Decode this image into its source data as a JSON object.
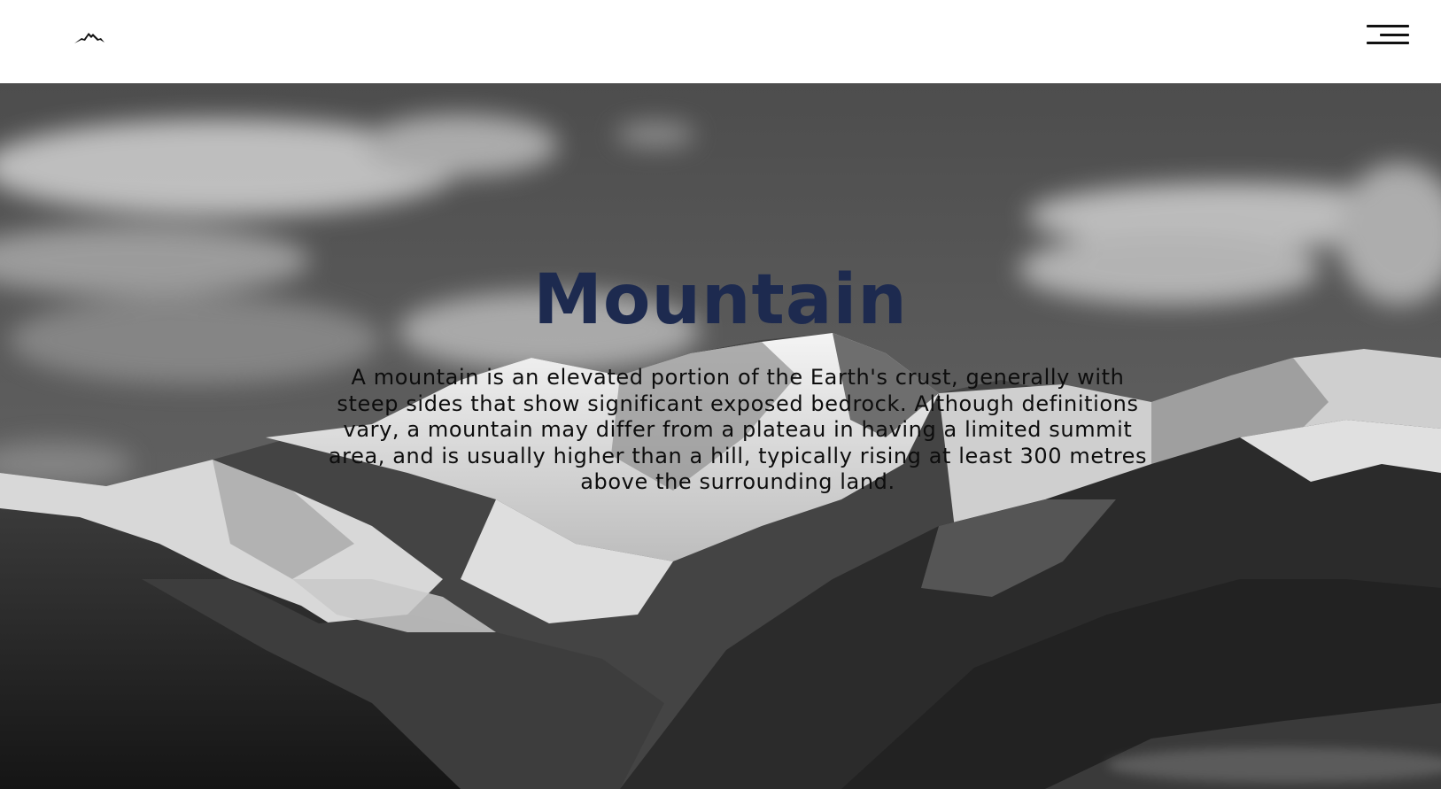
{
  "header": {
    "logo_icon": "mountain-logo-icon",
    "menu_icon": "hamburger-menu-icon"
  },
  "hero": {
    "title": "Mountain",
    "description": "A mountain is an elevated portion of the Earth's crust, generally with steep sides that show significant exposed bedrock. Although definitions vary, a mountain may differ from a plateau in having a limited summit area, and is usually higher than a hill, typically rising at least 300 metres above the surrounding land.",
    "title_color": "#1d2a4f",
    "background_image": "black-and-white-snowy-mountain-range-photo"
  }
}
